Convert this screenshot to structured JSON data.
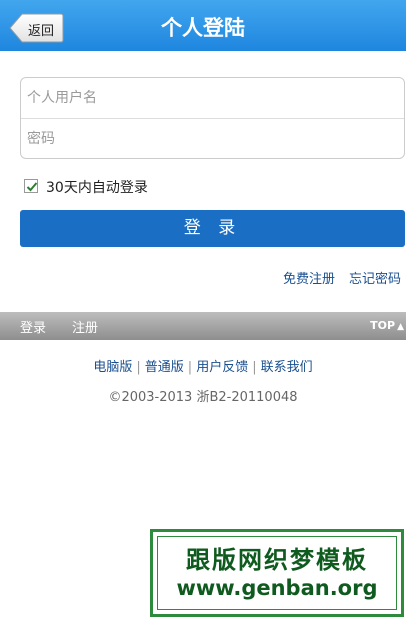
{
  "header": {
    "back_label": "返回",
    "title": "个人登陆",
    "background": "#2a90e4"
  },
  "form": {
    "username_placeholder": "个人用户名",
    "password_placeholder": "密码",
    "remember_label": "30天内自动登录",
    "remember_checked": true,
    "login_button": "登 录",
    "login_button_color": "#1a6ec4"
  },
  "links": {
    "register": "免费注册",
    "forgot": "忘记密码"
  },
  "bottom_bar": {
    "login": "登录",
    "register": "注册",
    "top": "TOP",
    "top_icon": "arrow-up-icon"
  },
  "footer": {
    "links": [
      "电脑版",
      "普通版",
      "用户反馈",
      "联系我们"
    ],
    "copyright": "©2003-2013 浙B2-20110048"
  },
  "watermark": {
    "line1": "跟版网织梦模板",
    "line2": "www.genban.org",
    "color": "#2e8b3e"
  }
}
